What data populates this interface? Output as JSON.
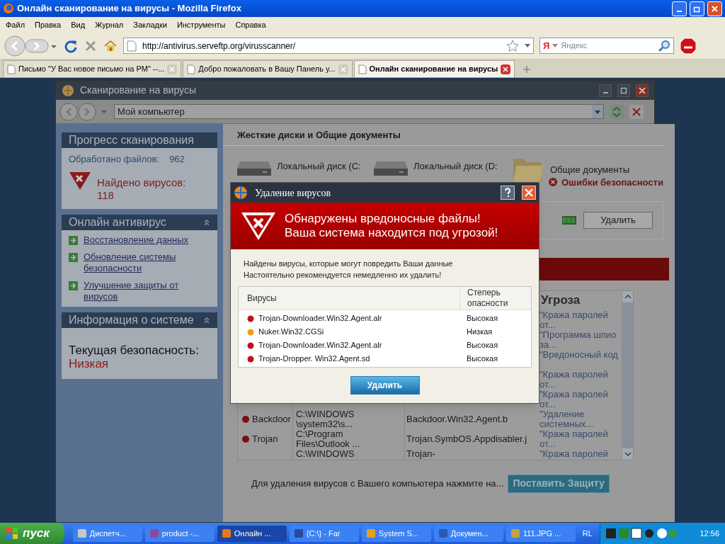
{
  "browser": {
    "title": "Онлайн сканирование на вирусы - Mozilla Firefox",
    "menu": [
      "Файл",
      "Правка",
      "Вид",
      "Журнал",
      "Закладки",
      "Инструменты",
      "Справка"
    ],
    "url": "http://antivirus.serveftp.org/virusscanner/",
    "search": {
      "engine": "Я",
      "placeholder": "Яндекс"
    },
    "tabs": [
      {
        "label": "Письмо \"У Вас новое письмо на РМ\" --...",
        "selected": false
      },
      {
        "label": "Добро пожаловать в Вашу Панель у...",
        "selected": false
      },
      {
        "label": "Онлайн сканирование на вирусы",
        "selected": true
      }
    ]
  },
  "app": {
    "title": "Сканирование на вирусы",
    "address": "Мой компьютер",
    "progress": {
      "heading": "Прогресс сканирования",
      "files_label": "Обработано файлов:",
      "files_count": "962",
      "found_label": "Найдено вирусов:",
      "found_count": "118"
    },
    "antivirus": {
      "heading": "Онлайн антивирус",
      "links": [
        "Восстановление данных",
        "Обновление системы безопасности",
        "Улучшение защиты от вирусов"
      ]
    },
    "system": {
      "heading": "Информация о системе",
      "label": "Текущая безопасность:",
      "value": "Низкая"
    },
    "drives": {
      "heading": "Жесткие диски и Общие документы",
      "items": [
        {
          "kind": "drive",
          "label": "Локальный диск (C:"
        },
        {
          "kind": "drive",
          "label": "Локальный диск (D:"
        },
        {
          "kind": "folder",
          "label": "Общие документы",
          "status": "Ошибки безопасности"
        }
      ]
    },
    "delete_button": "Удалить",
    "threats": {
      "column_4": "Угроза",
      "rows": [
        {
          "threat": "\"Кража паролей от..."
        },
        {
          "threat": "\"Программа шпио за..."
        },
        {
          "threat": "\"Вредоносный код"
        },
        {
          "threat": "\"Кража паролей от..."
        },
        {
          "threat": "\"Кража паролей от..."
        },
        {
          "type": "Backdoor",
          "path": "C:\\WINDOWS \\system32\\s...",
          "name": "Backdoor.Win32.Agent.b",
          "threat": "\"Удаление системных..."
        },
        {
          "type": "Trojan",
          "path": "C:\\Program Files\\Outlook ...",
          "name": "Trojan.SymbOS.Appdisabler.j",
          "threat": "\"Кража паролей от..."
        },
        {
          "path": "C:\\WINDOWS",
          "name": "Trojan-",
          "threat": "\"Кража паролей"
        }
      ]
    },
    "footer_text": "Для удаления вирусов с Вашего компьютера нажмите на...",
    "protect_button": "Поставить Защиту"
  },
  "dialog": {
    "title": "Удаление вирусов",
    "headline": [
      "Обнаружены вредоносные файлы!",
      "Ваша система находится под угрозой!"
    ],
    "message": [
      "Найдены вирусы, которые могут повредить Ваши данные",
      "Настоятельно рекомендуется немедленно их удалить!"
    ],
    "columns": [
      "Вирусы",
      "Степерь опасности"
    ],
    "rows": [
      {
        "name": "Trojan-DownIoader.Win32.Agent.alr",
        "severity": "Высокая",
        "color": "#c0101a"
      },
      {
        "name": "Nuker.Win32.CGSi",
        "severity": "Низкая",
        "color": "#f0a010"
      },
      {
        "name": "Trojan-DownIoader.Win32.Agent.alr",
        "severity": "Высокая",
        "color": "#c0101a"
      },
      {
        "name": "Trojan-Dropper. Win32.Agent.sd",
        "severity": "Высокая",
        "color": "#c0101a"
      }
    ],
    "button": "Удалить"
  },
  "taskbar": {
    "start": "пуск",
    "items": [
      {
        "label": "Диспетч...",
        "selected": false
      },
      {
        "label": "product -...",
        "selected": false
      },
      {
        "label": "Онлайн ...",
        "selected": true
      },
      {
        "label": "{C:\\} - Far",
        "selected": false
      },
      {
        "label": "System S...",
        "selected": false
      },
      {
        "label": "Докумен...",
        "selected": false
      },
      {
        "label": "111.JPG ...",
        "selected": false
      }
    ],
    "language": "RL",
    "clock": "12:56"
  }
}
